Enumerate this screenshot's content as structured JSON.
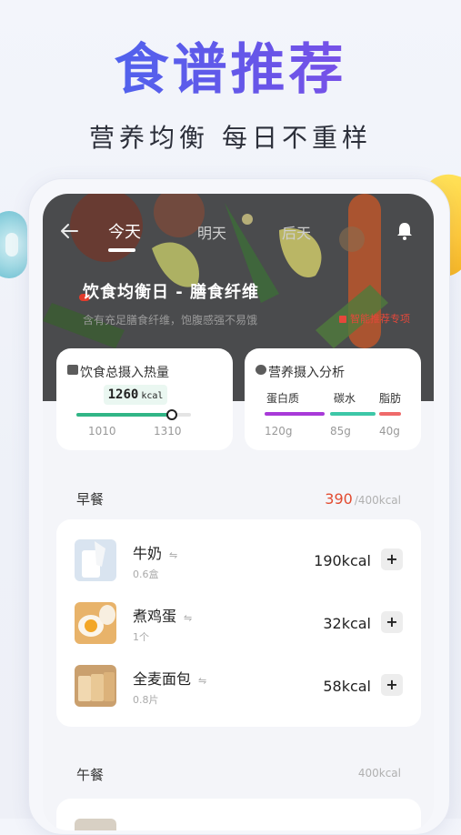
{
  "promo": {
    "title": "食谱推荐",
    "subtitle": "营养均衡 每日不重样"
  },
  "tabs": [
    "今天",
    "明天",
    "后天"
  ],
  "active_tab": "今天",
  "hero": {
    "title": "饮食均衡日 - 膳食纤维",
    "desc": "含有充足膳食纤维，饱腹感强不易饿",
    "badge": "智能推荐专项"
  },
  "calorie_card": {
    "title": "饮食总摄入热量",
    "value": "1260",
    "unit": "kcal",
    "min": "1010",
    "max": "1310",
    "progress": 0.83
  },
  "nutrition_card": {
    "title": "营养摄入分析",
    "items": [
      {
        "label": "蛋白质",
        "value": "120g",
        "color": "#a83ad8"
      },
      {
        "label": "碳水",
        "value": "85g",
        "color": "#3dc7a7"
      },
      {
        "label": "脂肪",
        "value": "40g",
        "color": "#ef6a6a"
      }
    ]
  },
  "breakfast": {
    "title": "早餐",
    "eaten": "390",
    "target": "/400kcal",
    "items": [
      {
        "name": "牛奶",
        "qty": "0.6盒",
        "kcal": "190kcal"
      },
      {
        "name": "煮鸡蛋",
        "qty": "1个",
        "kcal": "32kcal"
      },
      {
        "name": "全麦面包",
        "qty": "0.8片",
        "kcal": "58kcal"
      }
    ],
    "swap_symbol": "⇋",
    "add_symbol": "+"
  },
  "lunch": {
    "title": "午餐",
    "target": "400kcal"
  },
  "colors": {
    "accent_green": "#31b586",
    "accent_red": "#e24b30",
    "title_gradient_start": "#3f6cf0",
    "title_gradient_end": "#8f4ee6"
  }
}
